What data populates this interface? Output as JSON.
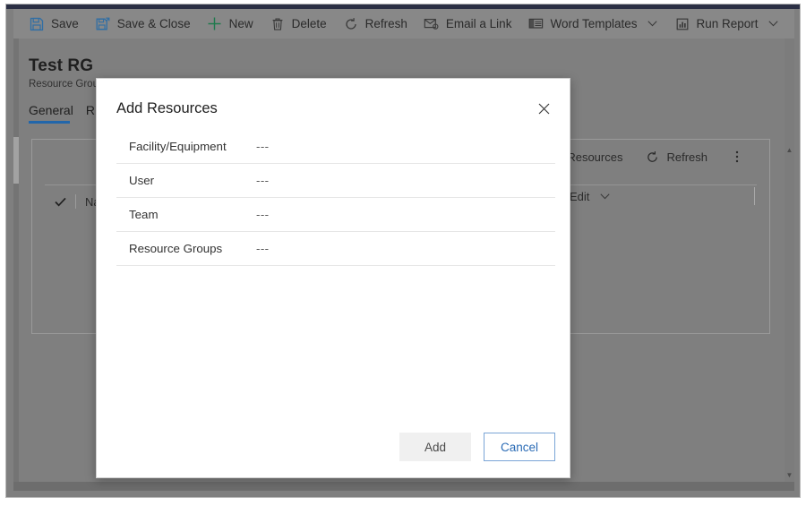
{
  "window": {
    "title_strip_color": "#2b2f44",
    "overlay_color": "#7f7f7f"
  },
  "command_bar": {
    "items": [
      {
        "label": "Save",
        "icon": "save-icon",
        "has_chevron": false
      },
      {
        "label": "Save & Close",
        "icon": "save-and-close-icon",
        "has_chevron": false
      },
      {
        "label": "New",
        "icon": "plus-icon",
        "has_chevron": false
      },
      {
        "label": "Delete",
        "icon": "trash-icon",
        "has_chevron": false
      },
      {
        "label": "Refresh",
        "icon": "refresh-icon",
        "has_chevron": false
      },
      {
        "label": "Email a Link",
        "icon": "email-link-icon",
        "has_chevron": false
      },
      {
        "label": "Word Templates",
        "icon": "word-template-icon",
        "has_chevron": true
      },
      {
        "label": "Run Report",
        "icon": "run-report-icon",
        "has_chevron": true
      }
    ]
  },
  "record": {
    "title": "Test RG",
    "subtitle": "Resource Group",
    "tabs": [
      {
        "label": "General",
        "active": true
      },
      {
        "label": "R",
        "active": false
      }
    ]
  },
  "subgrid": {
    "commands": [
      {
        "label": "Add Resources",
        "icon": "add-resources-icon"
      },
      {
        "label": "Refresh",
        "icon": "refresh-icon"
      },
      {
        "label": "",
        "icon": "overflow-menu-icon"
      }
    ],
    "columns": [
      {
        "label": "Name"
      },
      {
        "label": "Edit",
        "has_chevron": true
      }
    ],
    "select_all_icon": "checkmark-icon"
  },
  "dialog": {
    "title": "Add Resources",
    "close_icon": "close-icon",
    "fields": [
      {
        "label": "Facility/Equipment",
        "value": "---"
      },
      {
        "label": "User",
        "value": "---"
      },
      {
        "label": "Team",
        "value": "---"
      },
      {
        "label": "Resource Groups",
        "value": "---"
      }
    ],
    "buttons": {
      "add": "Add",
      "cancel": "Cancel"
    },
    "accent_color": "#2a6bb5"
  },
  "scrollbar": {
    "up_arrow": "▲",
    "down_arrow": "▼"
  }
}
